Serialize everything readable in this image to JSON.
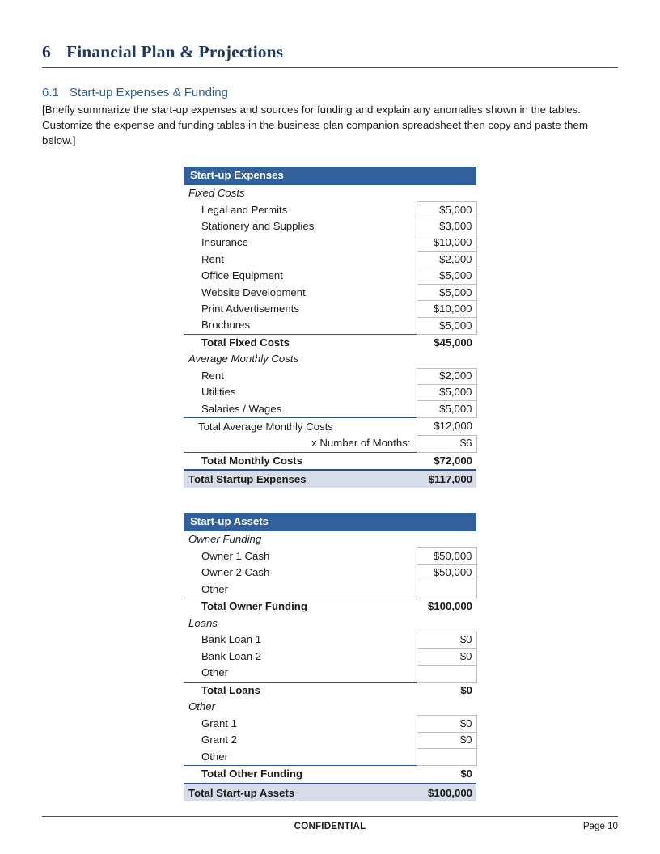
{
  "heading": {
    "number": "6",
    "title": "Financial Plan & Projections"
  },
  "subheading": {
    "number": "6.1",
    "title": "Start-up Expenses & Funding"
  },
  "body_paragraph": "[Briefly summarize the start-up expenses and sources for funding and explain any anomalies shown in the tables. Customize the expense and funding tables in the business plan companion spreadsheet then copy and paste them below.]",
  "colors": {
    "heading_navy": "#1F3864",
    "subheading_blue": "#2E5F92",
    "table_header_blue": "#31609C",
    "grand_total_fill": "#D6DCE8",
    "rule_blue": "#2C5289",
    "cell_border": "#BFBFBF"
  },
  "expenses_table": {
    "header": "Start-up Expenses",
    "sections": [
      {
        "name": "Fixed Costs",
        "items": [
          {
            "label": "Legal and Permits",
            "value": "$5,000"
          },
          {
            "label": "Stationery and Supplies",
            "value": "$3,000"
          },
          {
            "label": "Insurance",
            "value": "$10,000"
          },
          {
            "label": "Rent",
            "value": "$2,000"
          },
          {
            "label": "Office Equipment",
            "value": "$5,000"
          },
          {
            "label": "Website Development",
            "value": "$5,000"
          },
          {
            "label": "Print Advertisements",
            "value": "$10,000"
          },
          {
            "label": "Brochures",
            "value": "$5,000"
          }
        ],
        "subtotal": {
          "label": "Total Fixed Costs",
          "value": "$45,000"
        }
      },
      {
        "name": "Average Monthly Costs",
        "items": [
          {
            "label": "Rent",
            "value": "$2,000"
          },
          {
            "label": "Utilities",
            "value": "$5,000"
          },
          {
            "label": "Salaries / Wages",
            "value": "$5,000"
          }
        ],
        "plain_subtotal": {
          "label": "Total Average Monthly Costs",
          "value": "$12,000"
        },
        "multiplier": {
          "label": "x Number of Months:",
          "value": "$6"
        },
        "subtotal": {
          "label": "Total Monthly Costs",
          "value": "$72,000"
        }
      }
    ],
    "grand_total": {
      "label": "Total Startup Expenses",
      "value": "$117,000"
    }
  },
  "assets_table": {
    "header": "Start-up Assets",
    "sections": [
      {
        "name": "Owner Funding",
        "items": [
          {
            "label": "Owner 1 Cash",
            "value": "$50,000"
          },
          {
            "label": "Owner 2 Cash",
            "value": "$50,000"
          },
          {
            "label": "Other",
            "value": ""
          }
        ],
        "subtotal": {
          "label": "Total Owner Funding",
          "value": "$100,000"
        }
      },
      {
        "name": "Loans",
        "items": [
          {
            "label": "Bank Loan 1",
            "value": "$0"
          },
          {
            "label": "Bank Loan 2",
            "value": "$0"
          },
          {
            "label": "Other",
            "value": ""
          }
        ],
        "subtotal": {
          "label": "Total Loans",
          "value": "$0"
        }
      },
      {
        "name": "Other",
        "items": [
          {
            "label": "Grant 1",
            "value": "$0"
          },
          {
            "label": "Grant 2",
            "value": "$0"
          },
          {
            "label": "Other",
            "value": ""
          }
        ],
        "subtotal": {
          "label": "Total Other Funding",
          "value": "$0"
        }
      }
    ],
    "grand_total": {
      "label": "Total Start-up Assets",
      "value": "$100,000"
    }
  },
  "footer": {
    "center": "CONFIDENTIAL",
    "page": "Page 10"
  }
}
